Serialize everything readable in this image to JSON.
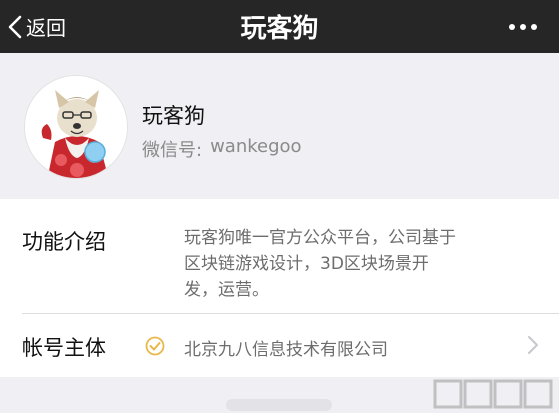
{
  "navbar": {
    "back_label": "返回",
    "title": "玩客狗"
  },
  "profile": {
    "name": "玩客狗",
    "id_label": "微信号:",
    "id_value": "wankegoo"
  },
  "info": {
    "intro_label": "功能介绍",
    "intro_lines": [
      "玩客狗唯一官方公众平台，公司基于",
      "区块链游戏设计，3D区块场景开",
      "发，运营。"
    ],
    "entity_label": "帐号主体",
    "entity_value": "北京九八信息技术有限公司"
  },
  "icons": {
    "back": "chevron-left-icon",
    "more": "more-dots-icon",
    "verified": "verified-check-icon",
    "chevron": "chevron-right-icon"
  },
  "colors": {
    "navbar_bg": "#262626",
    "verified": "#e9b84a",
    "page_bg": "#efeff4"
  }
}
